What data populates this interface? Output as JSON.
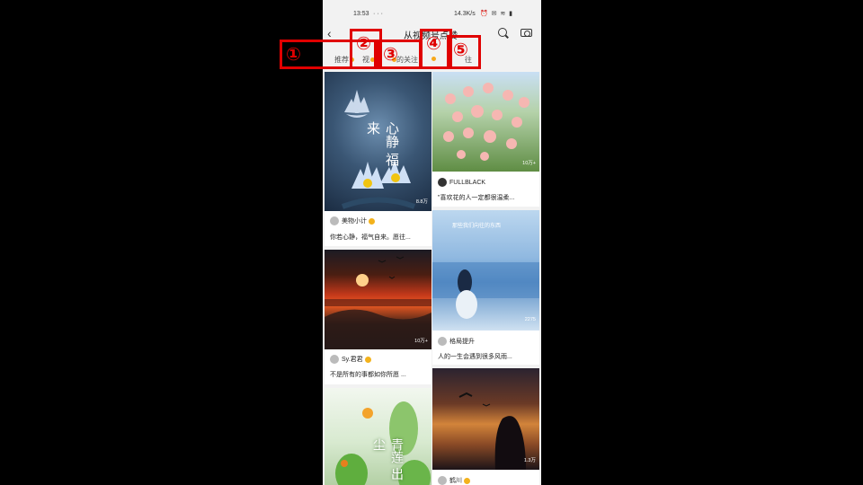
{
  "status_bar": {
    "time": "13:53",
    "dots": "···",
    "network_speed": "14.3K/s",
    "icons": "⏰ ✉ ≋ ▮"
  },
  "header": {
    "back_icon": "chevron-left-icon",
    "title": "从视频号点赞",
    "search_icon": "search-icon",
    "camera_icon": "camera-icon"
  },
  "tabs": [
    {
      "label": "推荐"
    },
    {
      "label": "视"
    },
    {
      "label": "的关注"
    },
    {
      "label": ""
    },
    {
      "label": "往"
    }
  ],
  "accent_color": "#f7a81b",
  "marker_color": "#e00000",
  "markers": [
    "①",
    "②",
    "③",
    "④",
    "⑤"
  ],
  "feed": {
    "left": [
      {
        "overlay": "心静 福来",
        "likes": "8.8万",
        "author": "美物小计",
        "verified": true,
        "caption": "你若心静，福气自来。愿往..."
      },
      {
        "likes": "10万+",
        "author": "Sy.君君",
        "verified": true,
        "caption": "不是所有的事都如你所愿 ..."
      },
      {
        "overlay": "青莲 出尘"
      }
    ],
    "right": [
      {
        "likes": "10万+",
        "author": "FULLBLACK",
        "verified": false,
        "caption": "\"喜欢花的人一定都很温柔..."
      },
      {
        "overlay": "那些我们向往的东西",
        "likes": "2275",
        "author": "格局提升",
        "verified": false,
        "caption": "人的一生会遇到很多风雨..."
      },
      {
        "likes": "1.3万",
        "author": "鹤川",
        "verified": true
      }
    ]
  }
}
